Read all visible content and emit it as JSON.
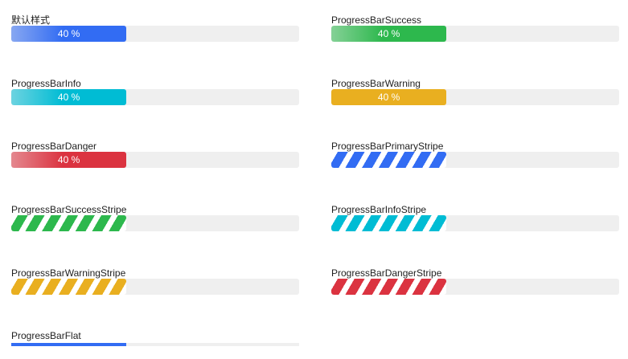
{
  "progress_bars": [
    {
      "label": "默认样式",
      "value_text": "40 %",
      "fraction": 0.4,
      "style": "gradient",
      "color": "#326CF3"
    },
    {
      "label": "ProgressBarSuccess",
      "value_text": "40 %",
      "fraction": 0.4,
      "style": "gradient",
      "color": "#2DB84D"
    },
    {
      "label": "ProgressBarInfo",
      "value_text": "40 %",
      "fraction": 0.4,
      "style": "gradient",
      "color": "#00BCD4"
    },
    {
      "label": "ProgressBarWarning",
      "value_text": "40 %",
      "fraction": 0.4,
      "style": "solid",
      "color": "#E9AF20"
    },
    {
      "label": "ProgressBarDanger",
      "value_text": "40 %",
      "fraction": 0.4,
      "style": "gradient",
      "color": "#DB3340"
    },
    {
      "label": "ProgressBarPrimaryStripe",
      "value_text": "",
      "fraction": 0.4,
      "style": "stripe",
      "color": "#326CF3"
    },
    {
      "label": "ProgressBarSuccessStripe",
      "value_text": "",
      "fraction": 0.4,
      "style": "stripe",
      "color": "#2DB84D"
    },
    {
      "label": "ProgressBarInfoStripe",
      "value_text": "",
      "fraction": 0.4,
      "style": "stripe",
      "color": "#00BCD4"
    },
    {
      "label": "ProgressBarWarningStripe",
      "value_text": "",
      "fraction": 0.4,
      "style": "stripe",
      "color": "#E9AF20"
    },
    {
      "label": "ProgressBarDangerStripe",
      "value_text": "",
      "fraction": 0.4,
      "style": "stripe",
      "color": "#DB3340"
    },
    {
      "label": "ProgressBarFlat",
      "value_text": "",
      "fraction": 0.4,
      "style": "flat",
      "color": "#326CF3"
    }
  ]
}
